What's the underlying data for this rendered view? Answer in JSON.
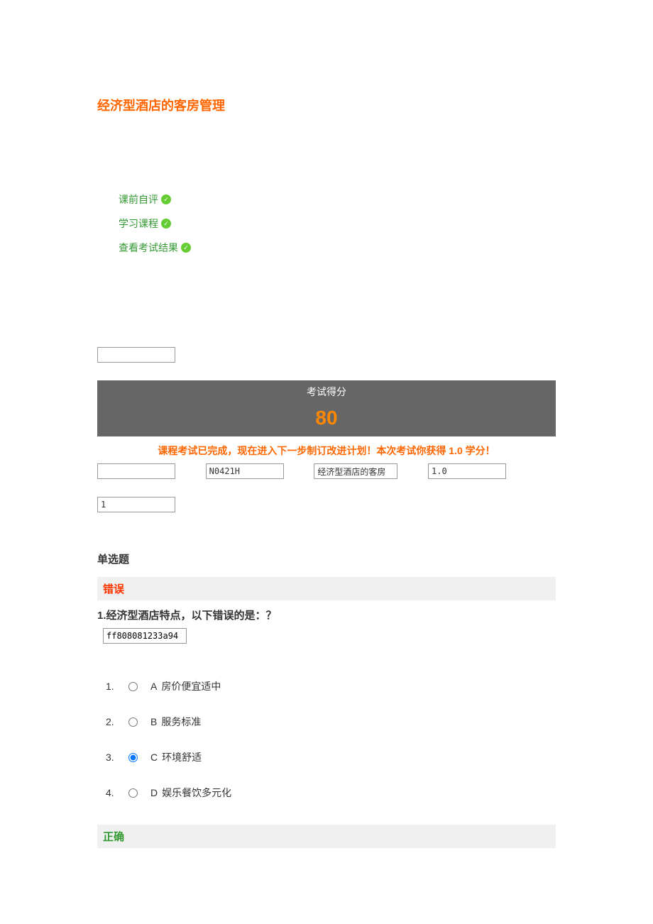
{
  "page_title": "经济型酒店的客房管理",
  "nav": [
    {
      "label": "课前自评"
    },
    {
      "label": "学习课程"
    },
    {
      "label": "查看考试结果"
    }
  ],
  "empty_input_1": "",
  "score_header": "考试得分",
  "score_value": "80",
  "completion_message": "课程考试已完成，现在进入下一步制订改进计划！本次考试你获得 1.0 学分！",
  "info": {
    "code": "N0421H",
    "course_name": "经济型酒店的客房",
    "credit": "1.0"
  },
  "input_1": "1",
  "section_title": "单选题",
  "q1": {
    "status": "错误",
    "text": "1.经济型酒店特点，以下错误的是：？",
    "qid": "ff808081233a94",
    "options": [
      {
        "num": "1.",
        "letter": "A",
        "text": "房价便宜适中",
        "selected": false
      },
      {
        "num": "2.",
        "letter": "B",
        "text": "服务标准",
        "selected": false
      },
      {
        "num": "3.",
        "letter": "C",
        "text": "环境舒适",
        "selected": true
      },
      {
        "num": "4.",
        "letter": "D",
        "text": "娱乐餐饮多元化",
        "selected": false
      }
    ]
  },
  "q2_status": "正确"
}
